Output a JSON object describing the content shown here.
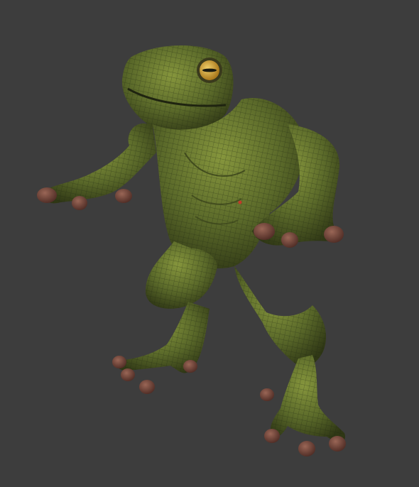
{
  "viewport": {
    "background": "#3d3d3d",
    "object": "frog-creature-sculpt",
    "display_mode": "wireframe-on-shaded",
    "colors": {
      "skin": "#5b6a2a",
      "skin_light": "#7f8f3a",
      "skin_dark": "#2f3715",
      "wire": "#1c2210",
      "toe_pad": "#6b4036",
      "toe_pad_light": "#9a6656",
      "eye_iris": "#c89a2a",
      "eye_light": "#f0cf6a",
      "pupil": "#1a1a10"
    }
  }
}
